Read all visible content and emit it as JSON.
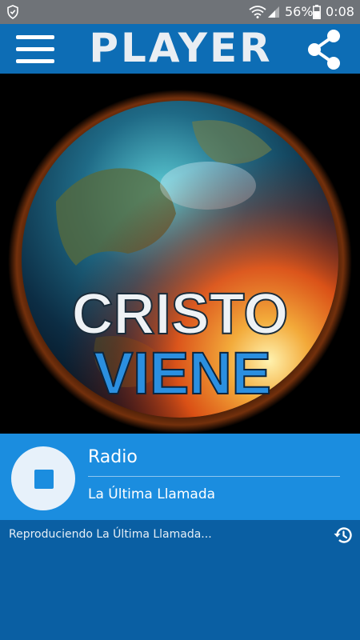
{
  "status_bar": {
    "battery": "56%",
    "time": "0:08"
  },
  "app_bar": {
    "title": "PLAYER",
    "menu_icon": "hamburger-menu-icon",
    "share_icon": "share-icon"
  },
  "artwork": {
    "line1": "CRISTO",
    "line2": "VIENE"
  },
  "player": {
    "station": "Radio",
    "track": "La Última Llamada",
    "stop_icon": "stop-icon"
  },
  "status": {
    "text": "Reproduciendo La Última Llamada...",
    "history_icon": "history-icon"
  },
  "colors": {
    "app_bar": "#0d6db5",
    "player_panel": "#1b8ddf",
    "background": "#0a5fa3",
    "status_bar": "#6f7378"
  }
}
